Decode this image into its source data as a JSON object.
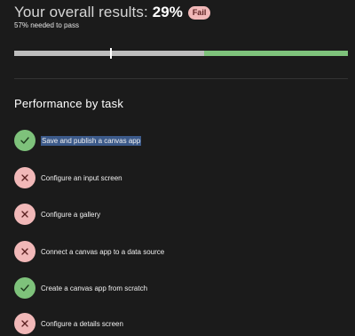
{
  "results": {
    "title": "Your overall results:",
    "score": "29%",
    "status_badge": "Fail",
    "pass_requirement": "57% needed to pass",
    "score_value": 0.29,
    "pass_threshold": 0.57
  },
  "performance": {
    "title": "Performance by task",
    "tasks": [
      {
        "label": "Save and publish a canvas app",
        "status": "pass",
        "icon": "check-icon",
        "selected": true
      },
      {
        "label": "Configure an input screen",
        "status": "fail",
        "icon": "x-icon"
      },
      {
        "label": "Configure a gallery",
        "status": "fail",
        "icon": "x-icon"
      },
      {
        "label": "Connect a canvas app to a data source",
        "status": "fail",
        "icon": "x-icon"
      },
      {
        "label": "Create a canvas app from scratch",
        "status": "pass",
        "icon": "check-icon"
      },
      {
        "label": "Configure a details screen",
        "status": "fail",
        "icon": "x-icon"
      }
    ]
  },
  "colors": {
    "background": "#1b1b1b",
    "pass": "#7ec27b",
    "fail": "#f1b8b8",
    "bar_track": "#bdbdbd",
    "selection": "#3c5a8a"
  }
}
